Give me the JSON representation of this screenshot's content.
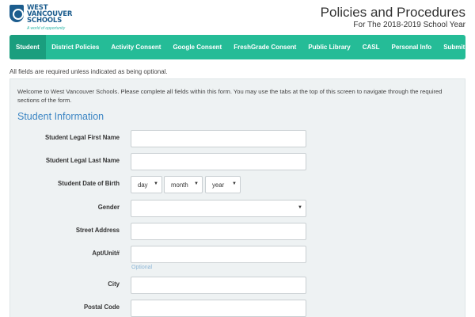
{
  "logo": {
    "line1": "WEST",
    "line2": "VANCOUVER",
    "line3": "SCHOOLS",
    "tagline": "A world of opportunity",
    "brand_color": "#1c5d8e"
  },
  "header": {
    "title": "Policies and Procedures",
    "subtitle": "For The 2018-2019 School Year"
  },
  "tabs": [
    {
      "label": "Student",
      "active": true
    },
    {
      "label": "District Policies"
    },
    {
      "label": "Activity Consent"
    },
    {
      "label": "Google Consent"
    },
    {
      "label": "FreshGrade Consent"
    },
    {
      "label": "Public Library"
    },
    {
      "label": "CASL"
    },
    {
      "label": "Personal Info"
    },
    {
      "label": "Submit"
    }
  ],
  "colors": {
    "accent": "#25bc97",
    "accent_active": "#1a9e7e",
    "section_title": "#3c86c4",
    "panel_bg": "#eef2f3"
  },
  "note": "All fields are required unless indicated as being optional.",
  "intro": "Welcome to West Vancouver Schools. Please complete all fields within this form. You may use the tabs at the top of this screen to navigate through the required sections of the form.",
  "section_title": "Student Information",
  "fields": {
    "first_name": {
      "label": "Student Legal First Name",
      "value": ""
    },
    "last_name": {
      "label": "Student Legal Last Name",
      "value": ""
    },
    "dob": {
      "label": "Student Date of Birth",
      "day": "day",
      "month": "month",
      "year": "year"
    },
    "gender": {
      "label": "Gender",
      "value": ""
    },
    "street": {
      "label": "Street Address",
      "value": ""
    },
    "apt": {
      "label": "Apt/Unit#",
      "value": "",
      "hint": "Optional"
    },
    "city": {
      "label": "City",
      "value": ""
    },
    "postal": {
      "label": "Postal Code",
      "value": ""
    }
  }
}
